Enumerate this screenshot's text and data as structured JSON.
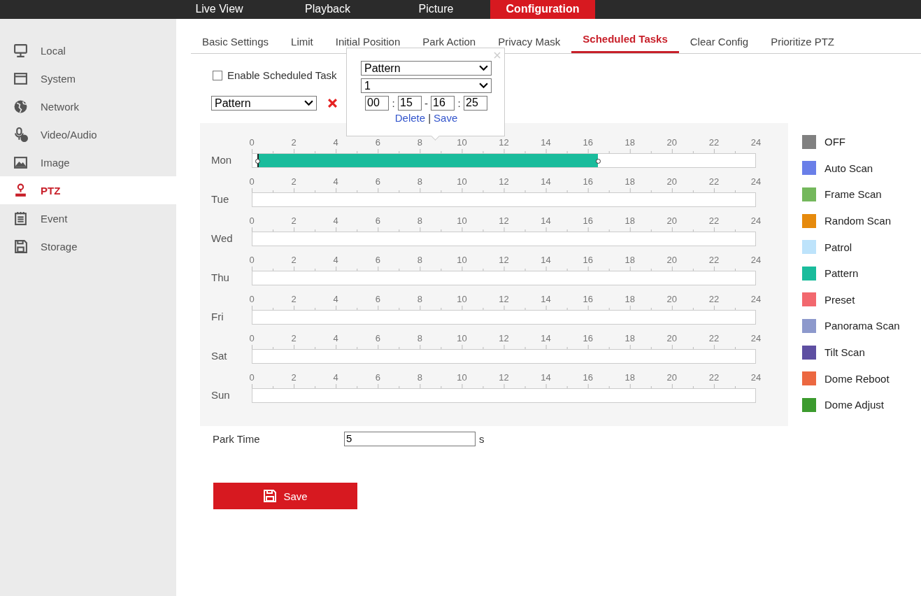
{
  "top_nav": [
    {
      "label": "Live View",
      "selected": false
    },
    {
      "label": "Playback",
      "selected": false
    },
    {
      "label": "Picture",
      "selected": false
    },
    {
      "label": "Configuration",
      "selected": true
    }
  ],
  "sidebar": {
    "items": [
      {
        "label": "Local",
        "selected": false
      },
      {
        "label": "System",
        "selected": false
      },
      {
        "label": "Network",
        "selected": false
      },
      {
        "label": "Video/Audio",
        "selected": false
      },
      {
        "label": "Image",
        "selected": false
      },
      {
        "label": "PTZ",
        "selected": true
      },
      {
        "label": "Event",
        "selected": false
      },
      {
        "label": "Storage",
        "selected": false
      }
    ]
  },
  "tabs": [
    {
      "label": "Basic Settings",
      "selected": false
    },
    {
      "label": "Limit",
      "selected": false
    },
    {
      "label": "Initial Position",
      "selected": false
    },
    {
      "label": "Park Action",
      "selected": false
    },
    {
      "label": "Privacy Mask",
      "selected": false
    },
    {
      "label": "Scheduled Tasks",
      "selected": true
    },
    {
      "label": "Clear Config",
      "selected": false
    },
    {
      "label": "Prioritize PTZ",
      "selected": false
    }
  ],
  "enable_task": {
    "label": "Enable Scheduled Task",
    "checked": false
  },
  "task_select": {
    "value": "Pattern"
  },
  "schedule": {
    "days": [
      {
        "label": "Mon",
        "ticks": [
          "0",
          "2",
          "4",
          "6",
          "8",
          "10",
          "12",
          "14",
          "16",
          "18",
          "20",
          "22",
          "24"
        ],
        "segment": {
          "color": "#1abc9c"
        }
      },
      {
        "label": "Tue",
        "ticks": [
          "0",
          "2",
          "4",
          "6",
          "8",
          "10",
          "12",
          "14",
          "16",
          "18",
          "20",
          "22",
          "24"
        ]
      },
      {
        "label": "Wed",
        "ticks": [
          "0",
          "2",
          "4",
          "6",
          "8",
          "10",
          "12",
          "14",
          "16",
          "18",
          "20",
          "22",
          "24"
        ]
      },
      {
        "label": "Thu",
        "ticks": [
          "0",
          "2",
          "4",
          "6",
          "8",
          "10",
          "12",
          "14",
          "16",
          "18",
          "20",
          "22",
          "24"
        ]
      },
      {
        "label": "Fri",
        "ticks": [
          "0",
          "2",
          "4",
          "6",
          "8",
          "10",
          "12",
          "14",
          "16",
          "18",
          "20",
          "22",
          "24"
        ]
      },
      {
        "label": "Sat",
        "ticks": [
          "0",
          "2",
          "4",
          "6",
          "8",
          "10",
          "12",
          "14",
          "16",
          "18",
          "20",
          "22",
          "24"
        ]
      },
      {
        "label": "Sun",
        "ticks": [
          "0",
          "2",
          "4",
          "6",
          "8",
          "10",
          "12",
          "14",
          "16",
          "18",
          "20",
          "22",
          "24"
        ]
      }
    ]
  },
  "popup": {
    "mode": "Pattern",
    "number": "1",
    "start_hour": "00",
    "start_minute": "15",
    "end_hour": "16",
    "end_minute": "25",
    "colon_1": ":",
    "dash": "-",
    "colon_2": ":",
    "separator": "|",
    "delete": "Delete",
    "save": "Save"
  },
  "legend": [
    {
      "label": "OFF",
      "color": "#808080"
    },
    {
      "label": "Auto Scan",
      "color": "#6a7fe8"
    },
    {
      "label": "Frame Scan",
      "color": "#74b85c"
    },
    {
      "label": "Random Scan",
      "color": "#e68a0c"
    },
    {
      "label": "Patrol",
      "color": "#bde3fb"
    },
    {
      "label": "Pattern",
      "color": "#1abc9c"
    },
    {
      "label": "Preset",
      "color": "#f2686e"
    },
    {
      "label": "Panorama Scan",
      "color": "#8d99cc"
    },
    {
      "label": "Tilt Scan",
      "color": "#5e4fa2"
    },
    {
      "label": "Dome Reboot",
      "color": "#ec6841"
    },
    {
      "label": "Dome Adjust",
      "color": "#3c9b2e"
    }
  ],
  "park_time": {
    "label": "Park Time",
    "value": "5",
    "unit": "s"
  },
  "save_button": {
    "label": "Save"
  }
}
